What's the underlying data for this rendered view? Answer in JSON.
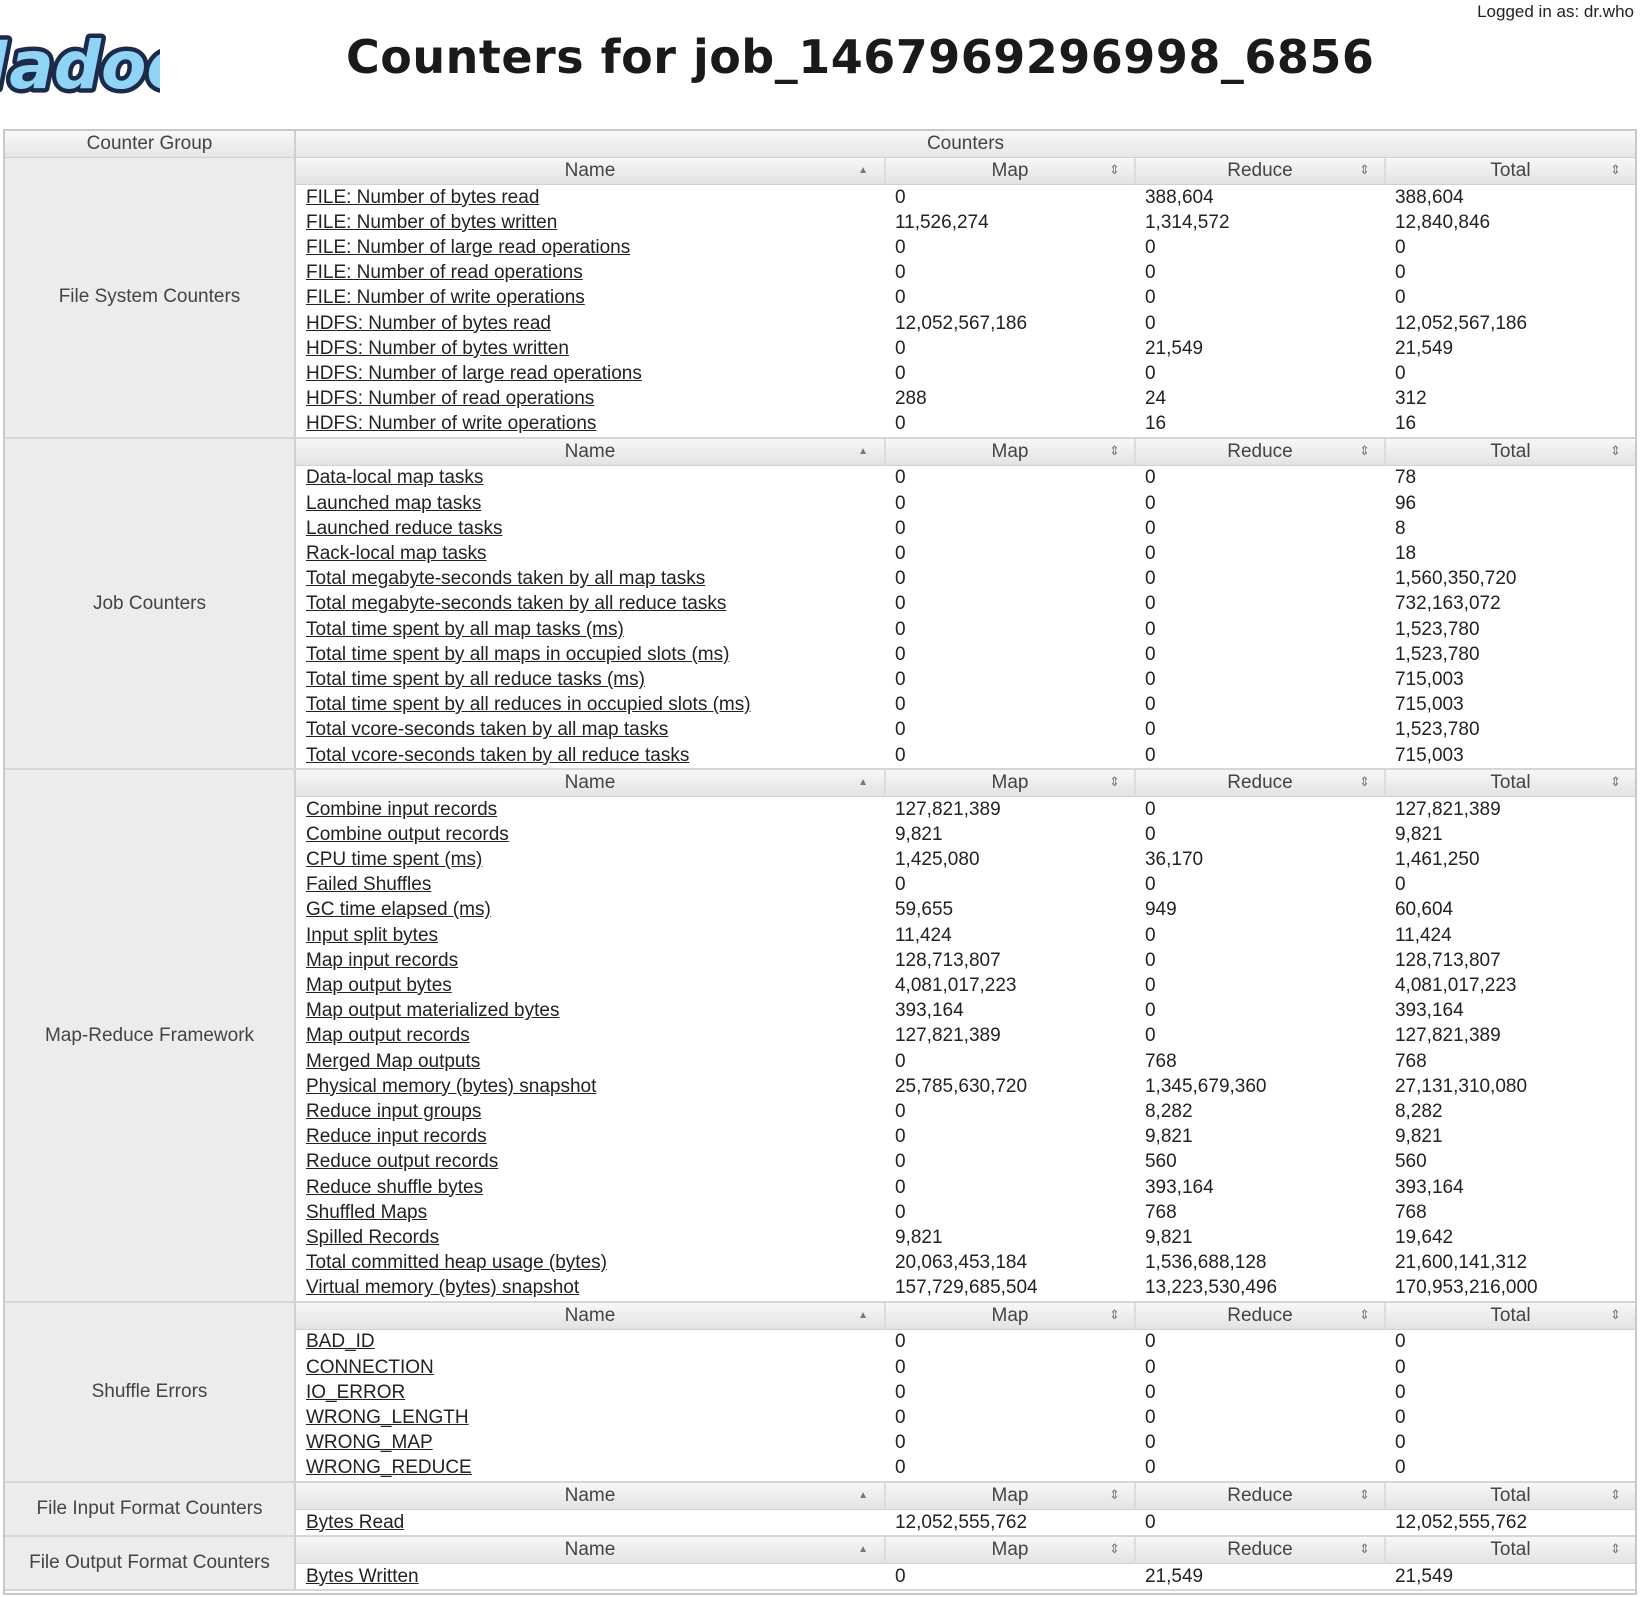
{
  "header": {
    "logo_text": "Hadoop",
    "logged_in": "Logged in as: dr.who",
    "title": "Counters for job_1467969296998_6856"
  },
  "table": {
    "group_header": "Counter Group",
    "counters_header": "Counters",
    "columns": [
      "Name",
      "Map",
      "Reduce",
      "Total"
    ],
    "groups": [
      {
        "name": "File System Counters",
        "rows": [
          [
            "FILE: Number of bytes read",
            "0",
            "388,604",
            "388,604"
          ],
          [
            "FILE: Number of bytes written",
            "11,526,274",
            "1,314,572",
            "12,840,846"
          ],
          [
            "FILE: Number of large read operations",
            "0",
            "0",
            "0"
          ],
          [
            "FILE: Number of read operations",
            "0",
            "0",
            "0"
          ],
          [
            "FILE: Number of write operations",
            "0",
            "0",
            "0"
          ],
          [
            "HDFS: Number of bytes read",
            "12,052,567,186",
            "0",
            "12,052,567,186"
          ],
          [
            "HDFS: Number of bytes written",
            "0",
            "21,549",
            "21,549"
          ],
          [
            "HDFS: Number of large read operations",
            "0",
            "0",
            "0"
          ],
          [
            "HDFS: Number of read operations",
            "288",
            "24",
            "312"
          ],
          [
            "HDFS: Number of write operations",
            "0",
            "16",
            "16"
          ]
        ]
      },
      {
        "name": "Job Counters",
        "rows": [
          [
            "Data-local map tasks",
            "0",
            "0",
            "78"
          ],
          [
            "Launched map tasks",
            "0",
            "0",
            "96"
          ],
          [
            "Launched reduce tasks",
            "0",
            "0",
            "8"
          ],
          [
            "Rack-local map tasks",
            "0",
            "0",
            "18"
          ],
          [
            "Total megabyte-seconds taken by all map tasks",
            "0",
            "0",
            "1,560,350,720"
          ],
          [
            "Total megabyte-seconds taken by all reduce tasks",
            "0",
            "0",
            "732,163,072"
          ],
          [
            "Total time spent by all map tasks (ms)",
            "0",
            "0",
            "1,523,780"
          ],
          [
            "Total time spent by all maps in occupied slots (ms)",
            "0",
            "0",
            "1,523,780"
          ],
          [
            "Total time spent by all reduce tasks (ms)",
            "0",
            "0",
            "715,003"
          ],
          [
            "Total time spent by all reduces in occupied slots (ms)",
            "0",
            "0",
            "715,003"
          ],
          [
            "Total vcore-seconds taken by all map tasks",
            "0",
            "0",
            "1,523,780"
          ],
          [
            "Total vcore-seconds taken by all reduce tasks",
            "0",
            "0",
            "715,003"
          ]
        ]
      },
      {
        "name": "Map-Reduce Framework",
        "rows": [
          [
            "Combine input records",
            "127,821,389",
            "0",
            "127,821,389"
          ],
          [
            "Combine output records",
            "9,821",
            "0",
            "9,821"
          ],
          [
            "CPU time spent (ms)",
            "1,425,080",
            "36,170",
            "1,461,250"
          ],
          [
            "Failed Shuffles",
            "0",
            "0",
            "0"
          ],
          [
            "GC time elapsed (ms)",
            "59,655",
            "949",
            "60,604"
          ],
          [
            "Input split bytes",
            "11,424",
            "0",
            "11,424"
          ],
          [
            "Map input records",
            "128,713,807",
            "0",
            "128,713,807"
          ],
          [
            "Map output bytes",
            "4,081,017,223",
            "0",
            "4,081,017,223"
          ],
          [
            "Map output materialized bytes",
            "393,164",
            "0",
            "393,164"
          ],
          [
            "Map output records",
            "127,821,389",
            "0",
            "127,821,389"
          ],
          [
            "Merged Map outputs",
            "0",
            "768",
            "768"
          ],
          [
            "Physical memory (bytes) snapshot",
            "25,785,630,720",
            "1,345,679,360",
            "27,131,310,080"
          ],
          [
            "Reduce input groups",
            "0",
            "8,282",
            "8,282"
          ],
          [
            "Reduce input records",
            "0",
            "9,821",
            "9,821"
          ],
          [
            "Reduce output records",
            "0",
            "560",
            "560"
          ],
          [
            "Reduce shuffle bytes",
            "0",
            "393,164",
            "393,164"
          ],
          [
            "Shuffled Maps",
            "0",
            "768",
            "768"
          ],
          [
            "Spilled Records",
            "9,821",
            "9,821",
            "19,642"
          ],
          [
            "Total committed heap usage (bytes)",
            "20,063,453,184",
            "1,536,688,128",
            "21,600,141,312"
          ],
          [
            "Virtual memory (bytes) snapshot",
            "157,729,685,504",
            "13,223,530,496",
            "170,953,216,000"
          ]
        ]
      },
      {
        "name": "Shuffle Errors",
        "rows": [
          [
            "BAD_ID",
            "0",
            "0",
            "0"
          ],
          [
            "CONNECTION",
            "0",
            "0",
            "0"
          ],
          [
            "IO_ERROR",
            "0",
            "0",
            "0"
          ],
          [
            "WRONG_LENGTH",
            "0",
            "0",
            "0"
          ],
          [
            "WRONG_MAP",
            "0",
            "0",
            "0"
          ],
          [
            "WRONG_REDUCE",
            "0",
            "0",
            "0"
          ]
        ]
      },
      {
        "name": "File Input Format Counters",
        "rows": [
          [
            "Bytes Read",
            "12,052,555,762",
            "0",
            "12,052,555,762"
          ]
        ]
      },
      {
        "name": "File Output Format Counters",
        "rows": [
          [
            "Bytes Written",
            "0",
            "21,549",
            "21,549"
          ]
        ]
      }
    ]
  },
  "icons": {
    "name_sort": "sort-asc-icon",
    "col_sort": "sort-both-icon"
  },
  "colors": {
    "logo_fill": "#8fd3f5",
    "logo_stroke": "#1d2b4a"
  }
}
